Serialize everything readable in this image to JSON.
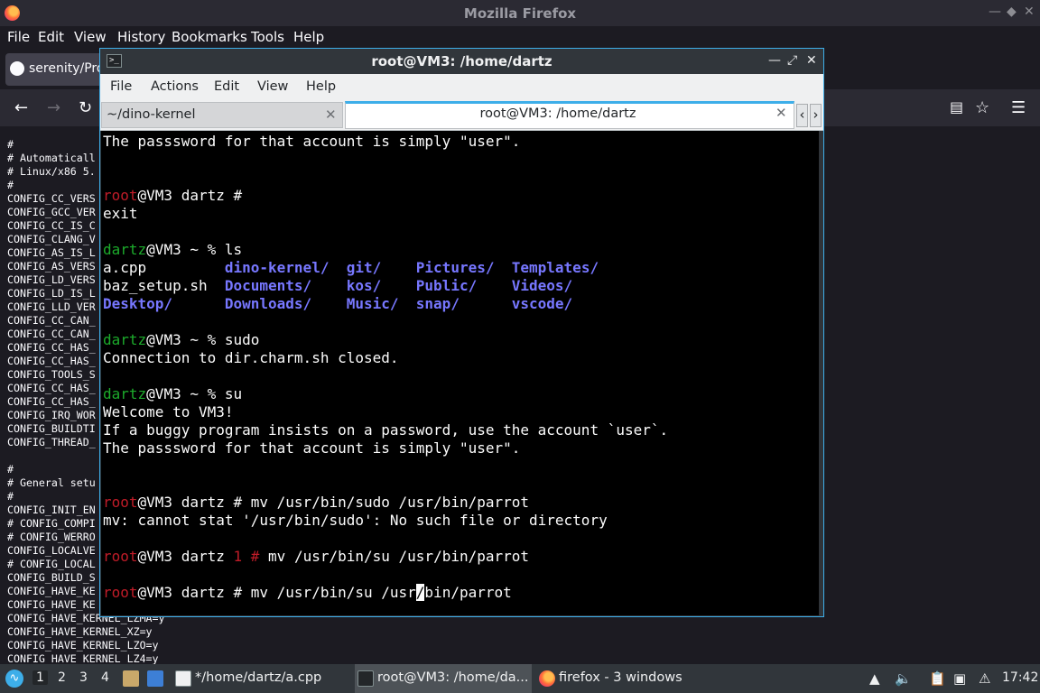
{
  "firefox": {
    "title": "Mozilla Firefox",
    "menus": [
      "File",
      "Edit",
      "View",
      "History",
      "Bookmarks",
      "Tools",
      "Help"
    ],
    "tab_label": "serenity/Pro",
    "content_lines": [
      "#",
      "# Automaticall",
      "# Linux/x86 5.",
      "#",
      "CONFIG_CC_VERS",
      "CONFIG_GCC_VER",
      "CONFIG_CC_IS_C",
      "CONFIG_CLANG_V",
      "CONFIG_AS_IS_L",
      "CONFIG_AS_VERS",
      "CONFIG_LD_VERS",
      "CONFIG_LD_IS_L",
      "CONFIG_LLD_VER",
      "CONFIG_CC_CAN_",
      "CONFIG_CC_CAN_",
      "CONFIG_CC_HAS_",
      "CONFIG_CC_HAS_",
      "CONFIG_TOOLS_S",
      "CONFIG_CC_HAS_",
      "CONFIG_CC_HAS_",
      "CONFIG_IRQ_WOR",
      "CONFIG_BUILDTI",
      "CONFIG_THREAD_",
      "",
      "#",
      "# General setu",
      "#",
      "CONFIG_INIT_EN",
      "# CONFIG_COMPI",
      "# CONFIG_WERRO",
      "CONFIG_LOCALVE",
      "# CONFIG_LOCAL",
      "CONFIG_BUILD_S",
      "CONFIG_HAVE_KE",
      "CONFIG_HAVE_KE",
      "CONFIG_HAVE_KERNEL_LZMA=y",
      "CONFIG_HAVE_KERNEL_XZ=y",
      "CONFIG_HAVE_KERNEL_LZO=y",
      "CONFIG_HAVE_KERNEL_LZ4=y"
    ]
  },
  "terminal": {
    "title": "root@VM3: /home/dartz",
    "menus": [
      "File",
      "Actions",
      "Edit",
      "View",
      "Help"
    ],
    "tabs": [
      {
        "label": "~/dino-kernel"
      },
      {
        "label": "root@VM3: /home/dartz"
      }
    ],
    "lines": [
      [
        {
          "t": "The passsword for that account is simply \"user\"."
        }
      ],
      [],
      [],
      [
        {
          "t": "root",
          "c": "red"
        },
        {
          "t": "@VM3 dartz #"
        }
      ],
      [
        {
          "t": "exit"
        }
      ],
      [],
      [
        {
          "t": "dartz",
          "c": "green"
        },
        {
          "t": "@VM3 ~ % ls"
        }
      ],
      [
        {
          "t": "a.cpp         "
        },
        {
          "t": "dino-kernel/",
          "c": "blue"
        },
        {
          "t": "  "
        },
        {
          "t": "git/",
          "c": "blue"
        },
        {
          "t": "    "
        },
        {
          "t": "Pictures/",
          "c": "blue"
        },
        {
          "t": "  "
        },
        {
          "t": "Templates/",
          "c": "blue"
        }
      ],
      [
        {
          "t": "baz_setup.sh  "
        },
        {
          "t": "Documents/",
          "c": "blue"
        },
        {
          "t": "    "
        },
        {
          "t": "kos/",
          "c": "blue"
        },
        {
          "t": "    "
        },
        {
          "t": "Public/",
          "c": "blue"
        },
        {
          "t": "    "
        },
        {
          "t": "Videos/",
          "c": "blue"
        }
      ],
      [
        {
          "t": "Desktop/",
          "c": "blue"
        },
        {
          "t": "      "
        },
        {
          "t": "Downloads/",
          "c": "blue"
        },
        {
          "t": "    "
        },
        {
          "t": "Music/",
          "c": "blue"
        },
        {
          "t": "  "
        },
        {
          "t": "snap/",
          "c": "blue"
        },
        {
          "t": "      "
        },
        {
          "t": "vscode/",
          "c": "blue"
        }
      ],
      [],
      [
        {
          "t": "dartz",
          "c": "green"
        },
        {
          "t": "@VM3 ~ % sudo"
        }
      ],
      [
        {
          "t": "Connection to dir.charm.sh closed."
        }
      ],
      [],
      [
        {
          "t": "dartz",
          "c": "green"
        },
        {
          "t": "@VM3 ~ % su"
        }
      ],
      [
        {
          "t": "Welcome to VM3!"
        }
      ],
      [
        {
          "t": "If a buggy program insists on a password, use the account `user`."
        }
      ],
      [
        {
          "t": "The passsword for that account is simply \"user\"."
        }
      ],
      [],
      [],
      [
        {
          "t": "root",
          "c": "red"
        },
        {
          "t": "@VM3 dartz # mv /usr/bin/sudo /usr/bin/parrot"
        }
      ],
      [
        {
          "t": "mv: cannot stat '/usr/bin/sudo': No such file or directory"
        }
      ],
      [],
      [
        {
          "t": "root",
          "c": "red"
        },
        {
          "t": "@VM3 dartz "
        },
        {
          "t": "1 #",
          "c": "red"
        },
        {
          "t": " mv /usr/bin/su /usr/bin/parrot"
        }
      ],
      [],
      [
        {
          "t": "root",
          "c": "red"
        },
        {
          "t": "@VM3 dartz # mv /usr/bin/su /usr"
        },
        {
          "t": "/",
          "c": "cursor"
        },
        {
          "t": "bin/parrot"
        }
      ]
    ]
  },
  "taskbar": {
    "workspaces": [
      "1",
      "2",
      "3",
      "4"
    ],
    "tasks": [
      {
        "label": "*/home/dartz/a.cpp"
      },
      {
        "label": "root@VM3: /home/da..."
      },
      {
        "label": "firefox - 3 windows"
      }
    ],
    "clock": "17:42"
  }
}
